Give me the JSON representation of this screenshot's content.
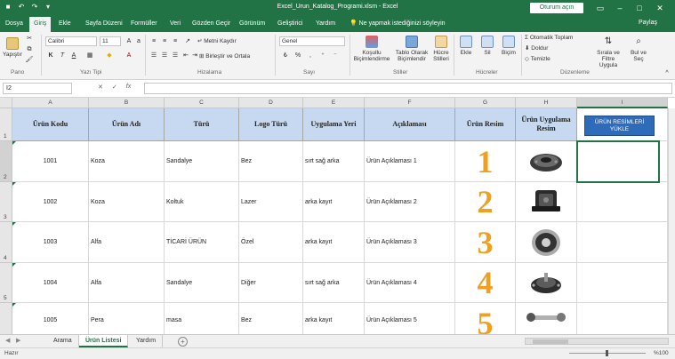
{
  "window": {
    "title": "Excel_Urun_Katalog_Programi.xlsm  -  Excel",
    "signin": "Oturum açın"
  },
  "tabs": [
    "Dosya",
    "Giriş",
    "Ekle",
    "Sayfa Düzeni",
    "Formüller",
    "Veri",
    "Gözden Geçir",
    "Görünüm",
    "Geliştirici",
    "Yardım"
  ],
  "tellme": "Ne yapmak istediğinizi söyleyin",
  "share": "Paylaş",
  "ribbon": {
    "paste": "Yapıştır",
    "font_name": "Calibri",
    "font_size": "11",
    "bold": "K",
    "italic": "T",
    "underline": "A",
    "wrap_text": "Metni Kaydır",
    "merge_center": "Birleştir ve Ortala",
    "number_format": "Genel",
    "cond_format": "Koşullu Biçimlendirme",
    "format_table": "Tablo Olarak Biçimlendir",
    "cell_styles": "Hücre Stilleri",
    "insert": "Ekle",
    "delete": "Sil",
    "format": "Biçim",
    "autosum": "Otomatik Toplam",
    "fill": "Doldur",
    "clear": "Temizle",
    "sort_filter": "Sırala ve Filtre Uygula",
    "find_select": "Bul ve Seç",
    "groups": {
      "clipboard": "Pano",
      "font": "Yazı Tipi",
      "alignment": "Hizalama",
      "number": "Sayı",
      "styles": "Stiller",
      "cells": "Hücreler",
      "editing": "Düzenleme"
    }
  },
  "formula_bar": {
    "namebox": "I2",
    "cancel": "✕",
    "enter": "✓",
    "fx": "fx",
    "content": ""
  },
  "columns": [
    "A",
    "B",
    "C",
    "D",
    "E",
    "F",
    "G",
    "H",
    "I"
  ],
  "rows": [
    "1",
    "2",
    "3",
    "4",
    "5"
  ],
  "table": {
    "headers": [
      "Ürün Kodu",
      "Ürün Adı",
      "Türü",
      "Logo Türü",
      "Uygulama Yeri",
      "Açıklaması",
      "Ürün Resim",
      "Ürün Uygulama Resim"
    ],
    "records": [
      {
        "code": "1001",
        "name": "Koza",
        "type": "Sandalye",
        "logo": "Bez",
        "place": "sırt sağ arka",
        "desc": "Ürün Açıklaması 1",
        "num": "1"
      },
      {
        "code": "1002",
        "name": "Koza",
        "type": "Koltuk",
        "logo": "Lazer",
        "place": "arka kayıt",
        "desc": "Ürün Açıklaması 2",
        "num": "2"
      },
      {
        "code": "1003",
        "name": "Alfa",
        "type": "TİCARİ ÜRÜN",
        "logo": "Özel",
        "place": "arka kayıt",
        "desc": "Ürün Açıklaması 3",
        "num": "3"
      },
      {
        "code": "1004",
        "name": "Alfa",
        "type": "Sandalye",
        "logo": "Diğer",
        "place": "sırt sağ arka",
        "desc": "Ürün Açıklaması 4",
        "num": "4"
      },
      {
        "code": "1005",
        "name": "Pera",
        "type": "masa",
        "logo": "Bez",
        "place": "arka kayıt",
        "desc": "Ürün Açıklaması 5",
        "num": "5"
      }
    ]
  },
  "upload_button": "ÜRÜN RESİMLERİ YÜKLE",
  "sheets": [
    {
      "label": "Arama",
      "active": false
    },
    {
      "label": "Ürün Listesi",
      "active": true
    },
    {
      "label": "Yardım",
      "active": false
    }
  ],
  "status": {
    "ready": "Hazır",
    "zoom": "%100"
  },
  "colors": {
    "excel_green": "#217346",
    "header_fill": "#c6d9f1",
    "number_orange": "#f0a020",
    "button_blue": "#2e6bb8"
  }
}
